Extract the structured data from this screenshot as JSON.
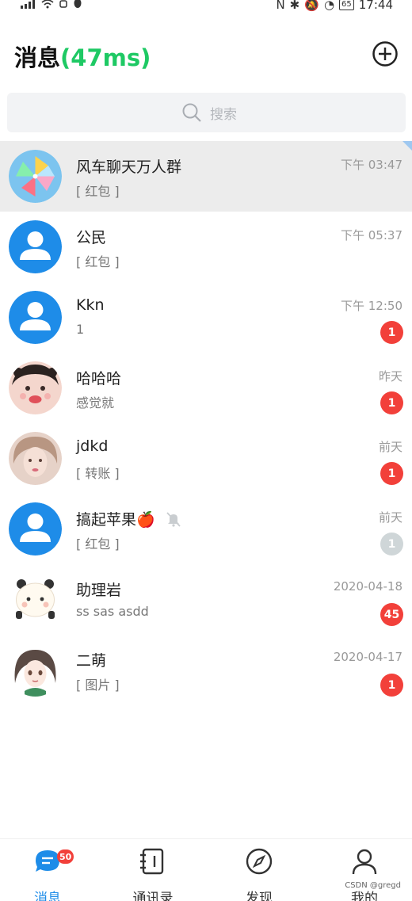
{
  "status_bar": {
    "left_icons": [
      "signal-icon",
      "wifi-icon",
      "usb-icon",
      "qq-icon"
    ],
    "right_icons": [
      "nfc-icon",
      "bluetooth-icon",
      "mute-icon",
      "data-icon"
    ],
    "battery": "65",
    "time": "17:44"
  },
  "header": {
    "title": "消息",
    "latency": "(47ms)",
    "add_icon": "plus-circle-icon"
  },
  "search": {
    "placeholder": "搜索",
    "icon": "search-icon"
  },
  "conversations": [
    {
      "name": "风车聊天万人群",
      "preview": "[ 红包 ]",
      "time": "下午 03:47",
      "badge": "",
      "active": true,
      "pinned": true
    },
    {
      "name": "公民",
      "preview": "[ 红包 ]",
      "time": "下午 05:37",
      "badge": ""
    },
    {
      "name": "Kkn",
      "preview": "1",
      "time": "下午 12:50",
      "badge": "1"
    },
    {
      "name": "哈哈哈",
      "preview": "感觉就",
      "time": "昨天",
      "badge": "1"
    },
    {
      "name": "jdkd",
      "preview": "[ 转账 ]",
      "time": "前天",
      "badge": "1"
    },
    {
      "name": "搞起苹果🍎",
      "preview": "[ 红包 ]",
      "time": "前天",
      "badge": "1",
      "muted": true
    },
    {
      "name": "助理岩",
      "preview": "ss  sas  asdd",
      "time": "2020-04-18",
      "badge": "45"
    },
    {
      "name": "二萌",
      "preview": "[ 图片 ]",
      "time": "2020-04-17",
      "badge": "1"
    }
  ],
  "bottom_nav": {
    "items": [
      {
        "label": "消息",
        "icon": "chat-icon",
        "badge": "50",
        "active": true
      },
      {
        "label": "通讯录",
        "icon": "contacts-icon"
      },
      {
        "label": "发现",
        "icon": "compass-icon"
      },
      {
        "label": "我的",
        "icon": "person-icon"
      }
    ]
  },
  "watermark": "CSDN @gregd",
  "colors": {
    "accent": "#1e8ce8",
    "latency": "#1ec964",
    "badge": "#f2403a",
    "muted_badge": "#cfd6d8"
  }
}
